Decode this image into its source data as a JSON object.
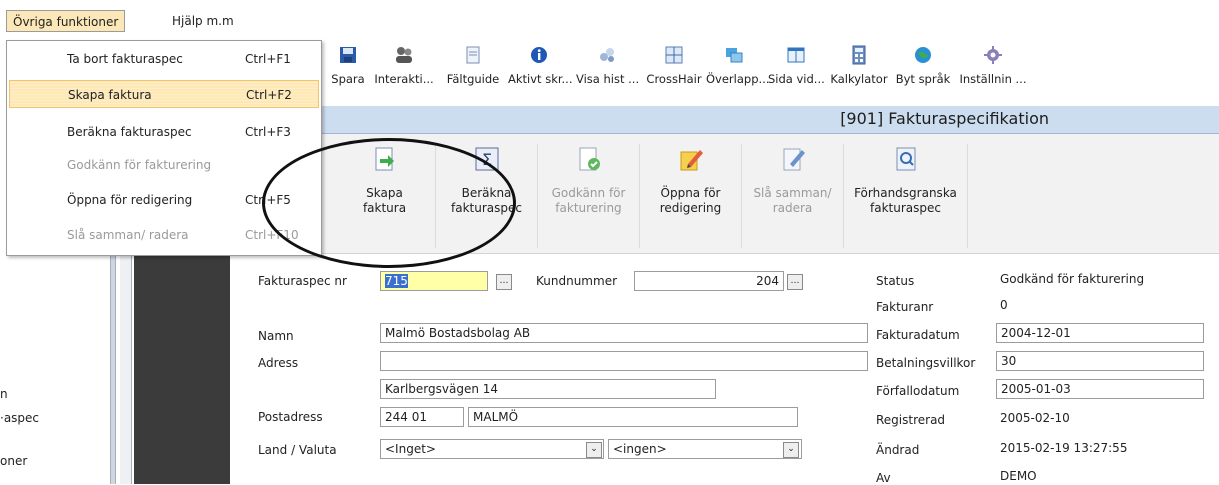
{
  "menubar": {
    "items": [
      "Övriga funktioner",
      "Hjälp m.m"
    ]
  },
  "dropdown": {
    "items": [
      {
        "label": "Ta bort fakturaspec",
        "shortcut": "Ctrl+F1"
      },
      {
        "label": "Skapa faktura",
        "shortcut": "Ctrl+F2"
      },
      {
        "label": "Beräkna fakturaspec",
        "shortcut": "Ctrl+F3"
      },
      {
        "label": "Godkänn för fakturering",
        "shortcut": ""
      },
      {
        "label": "Öppna för redigering",
        "shortcut": "Ctrl+F5"
      },
      {
        "label": "Slå samman/ radera",
        "shortcut": "Ctrl+F10"
      }
    ]
  },
  "toolbar": {
    "items": [
      "Spara",
      "Interakti...",
      "Fältguide",
      "Aktivt skr...",
      "Visa hist ...",
      "CrossHair",
      "Överlapp...",
      "Sida vid...",
      "Kalkylator",
      "Byt språk",
      "Inställnin ..."
    ]
  },
  "window": {
    "title": "[901]  Fakturaspecifikation"
  },
  "actions": {
    "skapa_1": "Skapa",
    "skapa_2": "faktura",
    "berakna_1": "Beräkna",
    "berakna_2": "fakturaspec",
    "godkann_1": "Godkänn för",
    "godkann_2": "fakturering",
    "oppna_1": "Öppna för",
    "oppna_2": "redigering",
    "sla_1": "Slå samman/",
    "sla_2": "radera",
    "forhand_1": "Förhandsgranska",
    "forhand_2": "fakturaspec"
  },
  "sidebar": {
    "items": [
      "n",
      "·aspec",
      "oner"
    ]
  },
  "form": {
    "fakturaspec_label": "Fakturaspec nr",
    "fakturaspec_value": "715",
    "kundnummer_label": "Kundnummer",
    "kundnummer_value": "204",
    "namn_label": "Namn",
    "namn_value": "Malmö Bostadsbolag AB",
    "adress_label": "Adress",
    "adress_value": "",
    "adress2_value": "Karlbergsvägen 14",
    "postadress_label": "Postadress",
    "postnr_value": "244 01",
    "ort_value": "MALMÖ",
    "land_label": "Land / Valuta",
    "land_value": "<Inget>",
    "valuta_value": "<ingen>"
  },
  "status": {
    "status_label": "Status",
    "status_value": "Godkänd för fakturering",
    "fakturanr_label": "Fakturanr",
    "fakturanr_value": "0",
    "fakturadatum_label": "Fakturadatum",
    "fakturadatum_value": "2004-12-01",
    "betalningsvillkor_label": "Betalningsvillkor",
    "betalningsvillkor_value": "30",
    "forfallodatum_label": "Förfallodatum",
    "forfallodatum_value": "2005-01-03",
    "registrerad_label": "Registrerad",
    "registrerad_value": "2005-02-10",
    "andrad_label": "Ändrad",
    "andrad_value": "2015-02-19 13:27:55",
    "av_label": "Av",
    "av_value": "DEMO"
  },
  "colors": {
    "title_band": "#cdddf0",
    "selected_menu": "#fde8b6",
    "dark_strip": "#3b3b3b",
    "highlight_field": "#ffffa8"
  }
}
